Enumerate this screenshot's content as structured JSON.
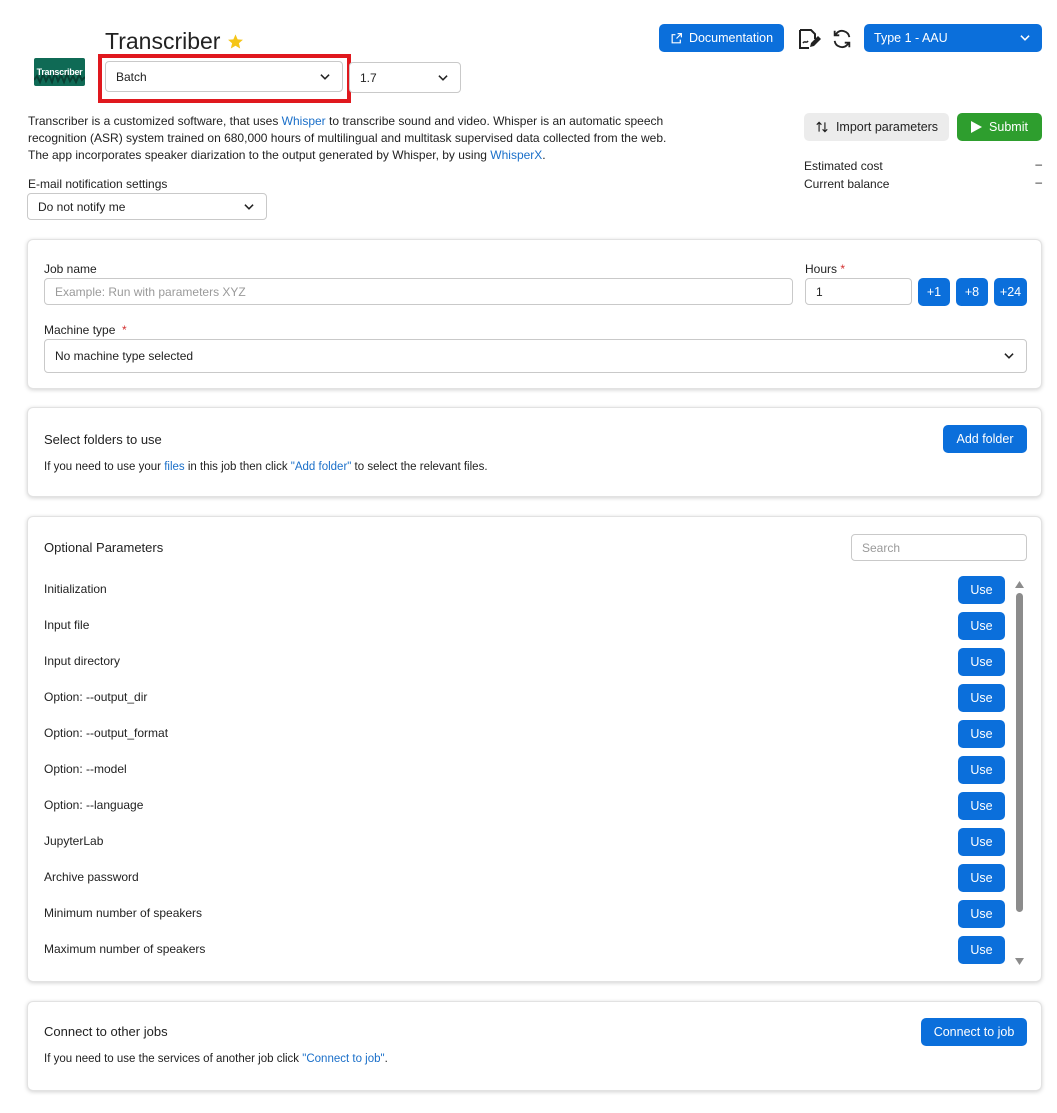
{
  "app": {
    "title": "Transcriber",
    "logo_text": "Transcriber",
    "description_parts": [
      "Transcriber is a customized software, that uses ",
      "Whisper",
      " to transcribe sound and video. Whisper is an automatic speech recognition (ASR) system trained on 680,000 hours of multilingual and multitask supervised data collected from the web. The app incorporates speaker diarization to the output generated by Whisper, by using ",
      "WhisperX",
      "."
    ]
  },
  "header": {
    "flavor_select": "Batch",
    "version_select": "1.7",
    "documentation_label": "Documentation",
    "product_select": "Type 1 - AAU",
    "import_label": "Import parameters",
    "submit_label": "Submit",
    "estimated_cost_label": "Estimated cost",
    "estimated_cost_value": "–",
    "balance_label": "Current balance",
    "balance_value": "–",
    "email_label": "E-mail notification settings",
    "email_select": "Do not notify me"
  },
  "job": {
    "name_label": "Job name",
    "name_placeholder": "Example: Run with parameters XYZ",
    "hours_label": "Hours",
    "hours_value": "1",
    "hour_buttons": [
      "+1",
      "+8",
      "+24"
    ],
    "machine_label": "Machine type",
    "machine_select": "No machine type selected"
  },
  "folders": {
    "title": "Select folders to use",
    "add_label": "Add folder",
    "text_parts": [
      "If you need to use your ",
      "files",
      " in this job then click ",
      "\"Add folder\"",
      " to select the relevant files."
    ]
  },
  "optional": {
    "title": "Optional Parameters",
    "search_placeholder": "Search",
    "use_label": "Use",
    "params": [
      "Initialization",
      "Input file",
      "Input directory",
      "Option: --output_dir",
      "Option: --output_format",
      "Option: --model",
      "Option: --language",
      "JupyterLab",
      "Archive password",
      "Minimum number of speakers",
      "Maximum number of speakers"
    ]
  },
  "connect": {
    "title": "Connect to other jobs",
    "button_label": "Connect to job",
    "text_parts": [
      "If you need to use the services of another job click ",
      "\"Connect to job\"",
      "."
    ]
  },
  "colors": {
    "primary": "#0b6fdb",
    "submit": "#2e9e2e",
    "highlight": "#e0181e",
    "star": "#f5c518"
  }
}
